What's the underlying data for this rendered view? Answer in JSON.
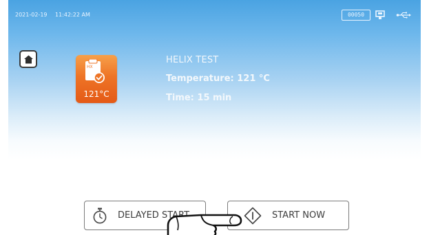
{
  "status_bar": {
    "date": "2021-02-19",
    "time": "11:42:22 AM",
    "cycle_counter": "00050",
    "icons": [
      "printer-icon",
      "usb-icon"
    ]
  },
  "navigation": {
    "home_icon": "home-icon"
  },
  "program": {
    "tile_code": "HX",
    "tile_temperature": "121°C",
    "tile_color": "#ee7426",
    "name": "HELIX TEST",
    "temperature_line": "Temperature: 121 °C",
    "time_line": "Time: 15 min"
  },
  "actions": {
    "delayed_start_label": "DELAYED START",
    "delayed_start_icon": "stopwatch-icon",
    "start_now_label": "START NOW",
    "start_now_icon": "start-diamond-icon"
  },
  "overlay": {
    "pointer_icon": "pointing-hand-icon"
  }
}
